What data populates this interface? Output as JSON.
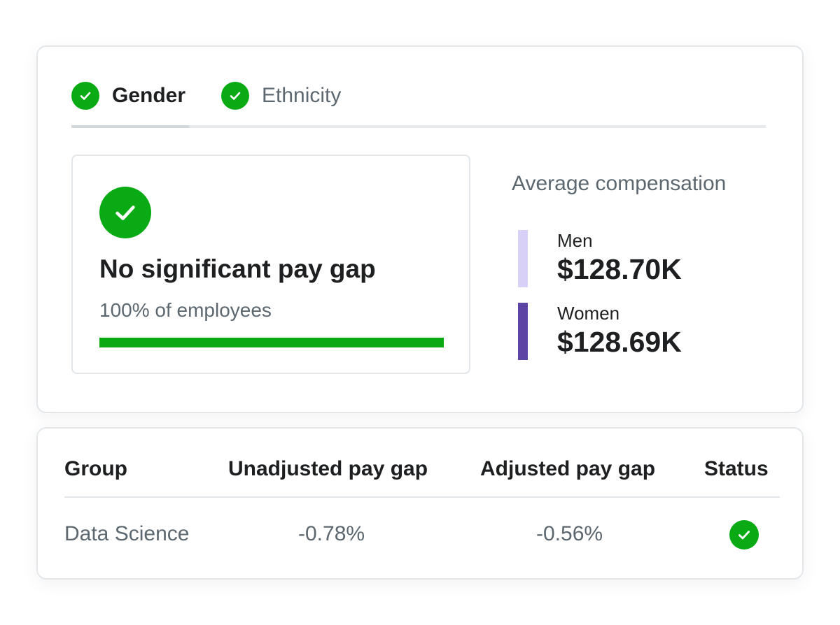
{
  "tabs": [
    {
      "label": "Gender",
      "active": true,
      "icon": "check-circle-icon"
    },
    {
      "label": "Ethnicity",
      "active": false,
      "icon": "check-circle-icon"
    }
  ],
  "summary": {
    "icon": "check-circle-icon",
    "title": "No significant pay gap",
    "subtitle": "100% of employees",
    "progress_percent": 100
  },
  "average_compensation": {
    "title": "Average compensation",
    "groups": [
      {
        "label": "Men",
        "value": "$128.70K",
        "color": "#d9d0f7"
      },
      {
        "label": "Women",
        "value": "$128.69K",
        "color": "#5b44a3"
      }
    ]
  },
  "table": {
    "columns": [
      "Group",
      "Unadjusted pay gap",
      "Adjusted pay gap",
      "Status"
    ],
    "rows": [
      {
        "group": "Data Science",
        "unadjusted": "-0.78%",
        "adjusted": "-0.56%",
        "status": "check-circle-icon"
      }
    ]
  },
  "colors": {
    "success": "#0aaa15",
    "text_primary": "#1d1f21",
    "text_secondary": "#5d6770",
    "border": "#e3e7ea"
  }
}
